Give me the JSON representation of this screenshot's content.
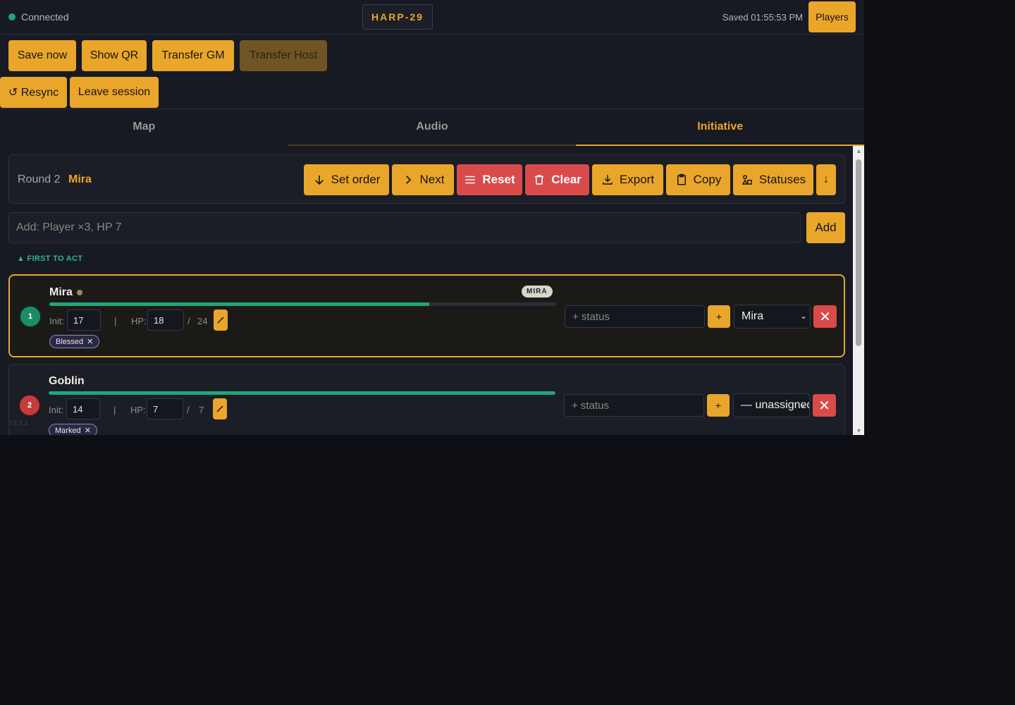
{
  "topbar": {
    "connection_status": "Connected",
    "room_code": "HARP-29",
    "saved_text": "Saved 01:55:53 PM",
    "players_label": "Players"
  },
  "actions": {
    "save_now": "Save now",
    "show_qr": "Show QR",
    "transfer_gm": "Transfer GM",
    "transfer_host": "Transfer Host",
    "resync": "↺ Resync",
    "leave_session": "Leave session"
  },
  "tabs": [
    {
      "label": "Map"
    },
    {
      "label": "Audio"
    },
    {
      "label": "Initiative"
    }
  ],
  "initiative": {
    "round_label": "Round 2",
    "current_name": "Mira",
    "controls": {
      "set_order": "Set order",
      "next": "Next",
      "reset": "Reset",
      "clear": "Clear",
      "export": "Export",
      "copy": "Copy",
      "statuses": "Statuses",
      "sort": "↓"
    },
    "add_placeholder": "Add: Player ×3, HP 7",
    "add_label": "Add",
    "first_to_act": "▲ FIRST TO ACT",
    "combatants": [
      {
        "rank": "1",
        "name": "Mira",
        "owner_badge": "MIRA",
        "hp_fraction": 0.75,
        "init_label": "Init:",
        "init": "17",
        "hp_label": "HP:",
        "hp": "18",
        "hp_max": "24",
        "separator": "|",
        "slash": "/",
        "tag": "Blessed",
        "status_placeholder": "+ status",
        "plus": "+",
        "assigned": "Mira"
      },
      {
        "rank": "2",
        "name": "Goblin",
        "hp_fraction": 1.0,
        "init_label": "Init:",
        "init": "14",
        "hp_label": "HP:",
        "hp": "7",
        "hp_max": "7",
        "separator": "|",
        "slash": "/",
        "tag": "Marked",
        "status_placeholder": "+ status",
        "plus": "+",
        "assigned": "— unassigned"
      }
    ]
  },
  "version": "v3.2.1",
  "colors": {
    "accent": "#e9a62a",
    "danger": "#d94a4a",
    "ok": "#1fa67a",
    "background": "#171923"
  }
}
